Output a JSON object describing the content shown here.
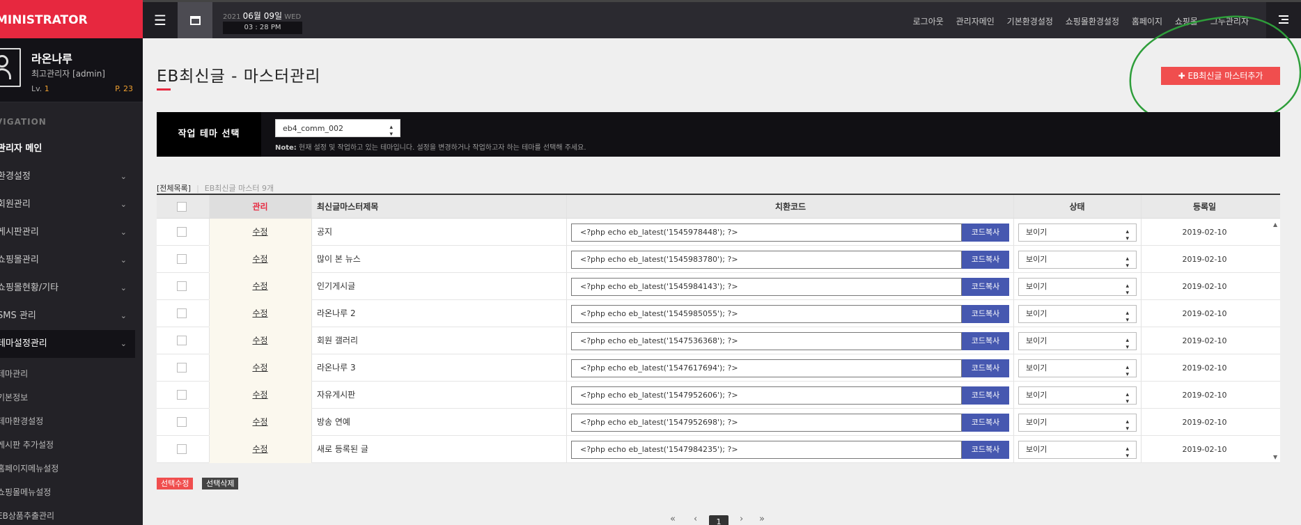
{
  "sidebar": {
    "brand": "MINISTRATOR",
    "profile": {
      "name": "라온나루",
      "role": "최고관리자 [admin]",
      "level_label": "Lv.",
      "level": "1",
      "points": "P. 23"
    },
    "nav_heading": "VIGATION",
    "items": [
      {
        "label": "관리자 메인",
        "chevron": false
      },
      {
        "label": "환경설정",
        "chevron": true
      },
      {
        "label": "회원관리",
        "chevron": true
      },
      {
        "label": "게시판관리",
        "chevron": true
      },
      {
        "label": "쇼핑몰관리",
        "chevron": true
      },
      {
        "label": "쇼핑몰현황/기타",
        "chevron": true
      },
      {
        "label": "SMS 관리",
        "chevron": true
      },
      {
        "label": "테마설정관리",
        "chevron": true
      }
    ],
    "subitems": [
      "테마관리",
      "기본정보",
      "테마환경설정",
      "게시판 추가설정",
      "홈페이지메뉴설정",
      "쇼핑몰메뉴설정",
      "EB상품추출관리"
    ]
  },
  "topbar": {
    "hamburger": "☰",
    "date_year": "2021",
    "date_md": "06월 09일",
    "date_dow": "WED",
    "time": "03 : 28 PM",
    "links": [
      "로그아웃",
      "관리자메인",
      "기본환경설정",
      "쇼핑몰환경설정",
      "홈페이지",
      "쇼핑몰",
      "그누관리자"
    ]
  },
  "page": {
    "title": "EB최신글 - 마스터관리",
    "add_button": "✚ EB최신글 마스터추가"
  },
  "theme_panel": {
    "label": "작업 테마 선택",
    "select_value": "eb4_comm_002",
    "note_label": "Note:",
    "note_text": " 현재 설정 및 작업하고 있는 테마입니다. 설정을 변경하거나 작업하고자 하는 테마를 선택해 주세요."
  },
  "list": {
    "all_label": "[전체목록]",
    "count_label": "EB최신글 마스터 9개"
  },
  "table": {
    "headers": {
      "mgmt": "관리",
      "title": "최신글마스터제목",
      "code": "치환코드",
      "status": "상태",
      "date": "등록일"
    },
    "edit_label": "수정",
    "copy_label": "코드복사",
    "rows": [
      {
        "title": "공지",
        "code": "<?php echo eb_latest('1545978448'); ?>",
        "status": "보이기",
        "date": "2019-02-10"
      },
      {
        "title": "많이 본 뉴스",
        "code": "<?php echo eb_latest('1545983780'); ?>",
        "status": "보이기",
        "date": "2019-02-10"
      },
      {
        "title": "인기게시글",
        "code": "<?php echo eb_latest('1545984143'); ?>",
        "status": "보이기",
        "date": "2019-02-10"
      },
      {
        "title": "라온나루 2",
        "code": "<?php echo eb_latest('1545985055'); ?>",
        "status": "보이기",
        "date": "2019-02-10"
      },
      {
        "title": "회원 갤러리",
        "code": "<?php echo eb_latest('1547536368'); ?>",
        "status": "보이기",
        "date": "2019-02-10"
      },
      {
        "title": "라온나루 3",
        "code": "<?php echo eb_latest('1547617694'); ?>",
        "status": "보이기",
        "date": "2019-02-10"
      },
      {
        "title": "자유게시판",
        "code": "<?php echo eb_latest('1547952606'); ?>",
        "status": "보이기",
        "date": "2019-02-10"
      },
      {
        "title": "방송 연예",
        "code": "<?php echo eb_latest('1547952698'); ?>",
        "status": "보이기",
        "date": "2019-02-10"
      },
      {
        "title": "새로 등록된 글",
        "code": "<?php echo eb_latest('1547984235'); ?>",
        "status": "보이기",
        "date": "2019-02-10"
      }
    ]
  },
  "bulk": {
    "edit_selected": "선택수정",
    "delete_selected": "선택삭제"
  },
  "pager": {
    "first": "«",
    "prev": "‹",
    "current": "1",
    "next": "›",
    "last": "»"
  },
  "colors": {
    "brand_red": "#e7283f",
    "copy_blue": "#4658b0",
    "annotation_green": "#2e9e3a"
  },
  "icons": {
    "hamburger": "hamburger-menu-icon",
    "window": "window-icon",
    "collapse": "sidebar-collapse-icon",
    "avatar": "user-avatar-icon"
  }
}
